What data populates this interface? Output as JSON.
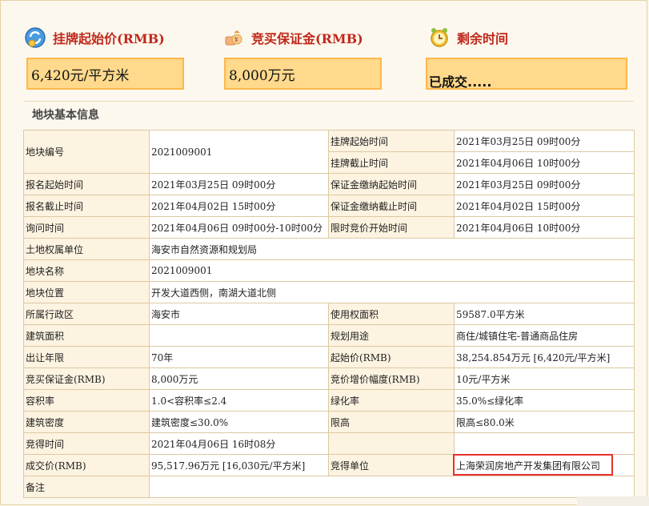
{
  "header": {
    "start_price_label": "挂牌起始价(RMB)",
    "start_price_value": "6,420元/平方米",
    "deposit_label": "竞买保证金(RMB)",
    "deposit_value": "8,000万元",
    "remaining_label": "剩余时间",
    "remaining_value": "已成交....."
  },
  "section_title": "地块基本信息",
  "info": {
    "parcel_no_label": "地块编号",
    "parcel_no": "2021009001",
    "list_start_label": "挂牌起始时间",
    "list_start": "2021年03月25日 09时00分",
    "list_end_label": "挂牌截止时间",
    "list_end": "2021年04月06日 10时00分",
    "reg_start_label": "报名起始时间",
    "reg_start": "2021年03月25日 09时00分",
    "deposit_start_label": "保证金缴纳起始时间",
    "deposit_start": "2021年03月25日 09时00分",
    "reg_end_label": "报名截止时间",
    "reg_end": "2021年04月02日 15时00分",
    "deposit_end_label": "保证金缴纳截止时间",
    "deposit_end": "2021年04月02日 15时00分",
    "inquiry_label": "询问时间",
    "inquiry": "2021年04月06日 09时00分-10时00分",
    "timed_bid_label": "限时竞价开始时间",
    "timed_bid": "2021年04月06日 10时00分",
    "owner_label": "土地权属单位",
    "owner": "海安市自然资源和规划局",
    "name_label": "地块名称",
    "name": "2021009001",
    "location_label": "地块位置",
    "location": "开发大道西侧，南湖大道北侧",
    "district_label": "所属行政区",
    "district": "海安市",
    "use_area_label": "使用权面积",
    "use_area": "59587.0平方米",
    "build_area_label": "建筑面积",
    "build_area": "",
    "plan_use_label": "规划用途",
    "plan_use": "商住/城镇住宅-普通商品住房",
    "term_label": "出让年限",
    "term": "70年",
    "start_price_label": "起始价(RMB)",
    "start_price": "38,254.854万元 [6,420元/平方米]",
    "deposit_label": "竞买保证金(RMB)",
    "deposit": "8,000万元",
    "increment_label": "竞价增价幅度(RMB)",
    "increment": "10元/平方米",
    "far_label": "容积率",
    "far": "1.0<容积率≤2.4",
    "green_label": "绿化率",
    "green": "35.0%≤绿化率",
    "density_label": "建筑密度",
    "density": "建筑密度≤30.0%",
    "height_label": "限高",
    "height": "限高≤80.0米",
    "win_time_label": "竞得时间",
    "win_time": "2021年04月06日 16时08分",
    "deal_price_label": "成交价(RMB)",
    "deal_price": "95,517.96万元 [16,030元/平方米]",
    "winner_label": "竞得单位",
    "winner": "上海荣润房地产开发集团有限公司",
    "remark_label": "备注",
    "remark": ""
  },
  "colors": {
    "accent_red": "#c0281c",
    "value_box": "#ffd98c",
    "value_border": "#ffb84a",
    "highlight_box": "#e8312d"
  }
}
